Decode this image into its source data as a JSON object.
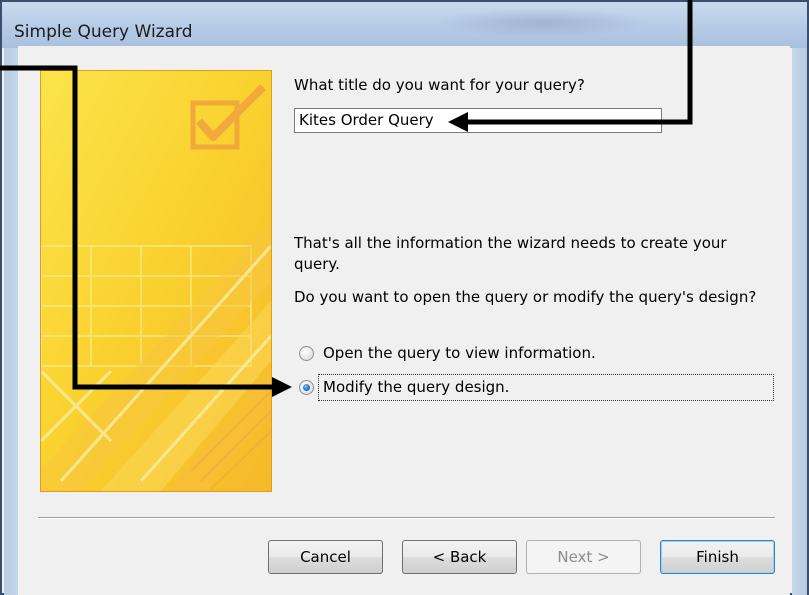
{
  "window": {
    "title": "Simple Query Wizard"
  },
  "wizard": {
    "title_prompt": "What title do you want for your query?",
    "title_value": "Kites Order Query",
    "info_line1": "That's all the information the wizard needs to create your",
    "info_line2": "query.",
    "open_or_modify_prompt": "Do you want to open the query or modify the query's design?",
    "option_open_label": "Open the query to view information.",
    "option_modify_label": "Modify the query design.",
    "selected_option": "Modify the query design."
  },
  "buttons": {
    "cancel": "Cancel",
    "back": "< Back",
    "next": "Next >",
    "finish": "Finish"
  },
  "colors": {
    "banner_yellow": "#f9d332",
    "banner_border": "#e39b1f",
    "annotation_arrow": "#000000",
    "titlebar": "#b7cce6"
  }
}
